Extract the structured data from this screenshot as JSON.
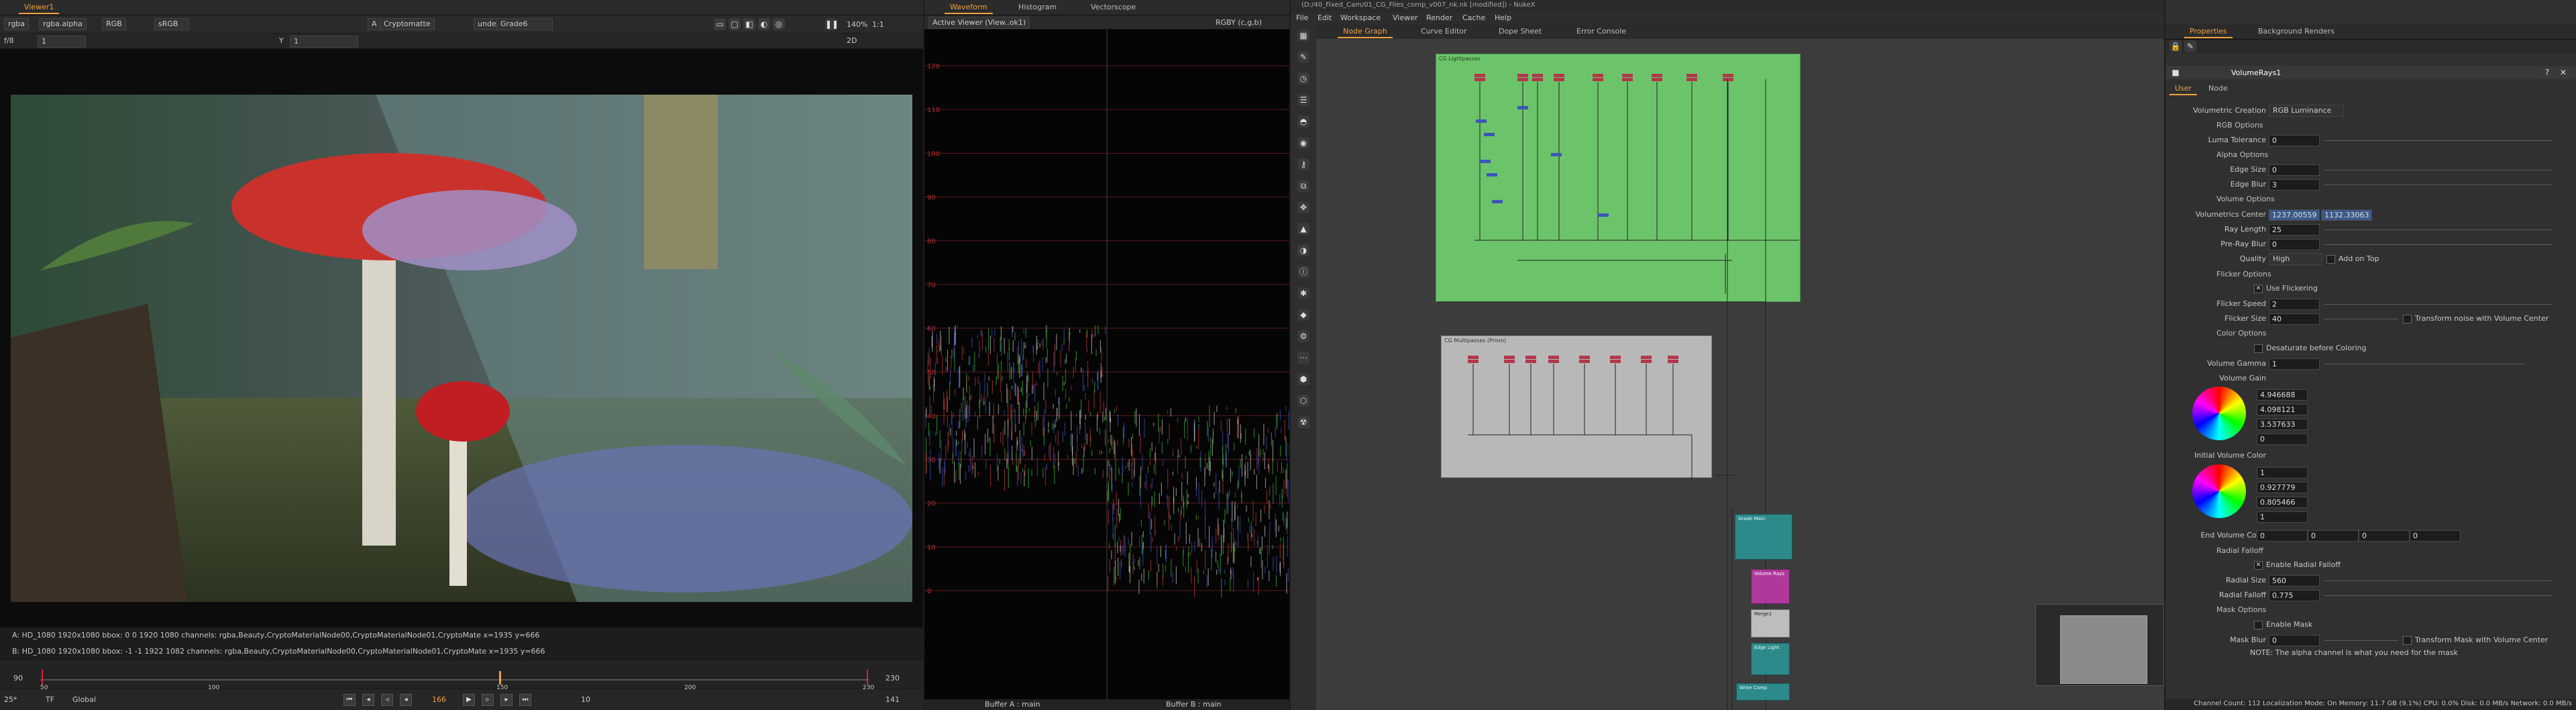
{
  "viewer": {
    "tab": "Viewer1",
    "toolbar": {
      "channels": "rgba",
      "channel_mode": "rgba.alpha",
      "display_mode": "RGB",
      "colorspace": "sRGB",
      "input_a": "A",
      "crypto": "Cryptomatte",
      "compare": "under",
      "input_b": "B",
      "grade": "Grade6",
      "zoom": "140%",
      "proxy": "1:1",
      "ratio_label": "f/8",
      "frame_field": "1",
      "y_label": "Y",
      "y_value": "1",
      "view_mode": "2D"
    },
    "info_a": "A:  HD_1080 1920x1080  bbox: 0 0 1920 1080 channels: rgba,Beauty,CryptoMaterialNode00,CryptoMaterialNode01,CryptoMate  x=1935 y=666",
    "info_b": "B:  HD_1080 1920x1080  bbox: -1 -1 1922 1082 channels: rgba,Beauty,CryptoMaterialNode00,CryptoMaterialNode01,CryptoMate  x=1935 y=666",
    "timeline": {
      "start": "90",
      "end": "230",
      "ticks": [
        "50",
        "100",
        "150",
        "200",
        "230"
      ],
      "fps": "25*",
      "tf": "TF",
      "scope": "Global",
      "current_frame": "166",
      "step": "10",
      "end_frame_field": "141"
    }
  },
  "scopes": {
    "tabs": [
      "Waveform",
      "Histogram",
      "Vectorscope"
    ],
    "active_tab": "Waveform",
    "source": "Active Viewer (View..ok1)",
    "mode": "RGBY (c,g,b)",
    "y_ticks": [
      "120",
      "110",
      "100",
      "90",
      "80",
      "70",
      "60",
      "50",
      "40",
      "30",
      "20",
      "10",
      "0"
    ],
    "buffer_a": "Buffer A : main",
    "buffer_b": "Buffer B : main"
  },
  "nodegraph": {
    "title": "(D:/40_Fixed_Cam/01_CG_Files_comp_v007_nk.nk [modified]) - NukeX",
    "menu": [
      "File",
      "Edit",
      "Workspace",
      "Viewer",
      "Render",
      "Cache",
      "Help"
    ],
    "tabs": [
      "Node Graph",
      "Curve Editor",
      "Dope Sheet",
      "Error Console"
    ],
    "backdrop_green_label": "CG Lightpasses",
    "backdrop_grey_label": "CG Multipasses (Prism)",
    "teal_nodes": [
      "Grade Main",
      "Volume Rays",
      "Merge1",
      "Edge Light",
      "Write Comp"
    ],
    "colors": {
      "backdrop_green": "#6cc46a",
      "backdrop_grey": "#b8b8b8",
      "teal": "#2d8a8a",
      "magenta": "#b0389c",
      "node_red": "#b3374a"
    }
  },
  "properties": {
    "tabs": [
      "Properties",
      "Background Renders"
    ],
    "node_name": "VolumeRays1",
    "sub_tabs": [
      "User",
      "Node"
    ],
    "volumetric_creation_label": "Volumetric Creation",
    "volumetric_creation": "RGB Luminance",
    "rgb_options": "RGB Options",
    "luma_tolerance_label": "Luma Tolerance",
    "luma_tolerance": "0",
    "alpha_options": "Alpha Options",
    "edge_size_label": "Edge Size",
    "edge_size": "0",
    "edge_blur_label": "Edge Blur",
    "edge_blur": "3",
    "volume_options": "Volume Options",
    "volumetrics_center_label": "Volumetrics Center",
    "center_x": "1237.00559",
    "center_y": "1132.33063",
    "ray_length_label": "Ray Length",
    "ray_length": "25",
    "pre_ray_blur_label": "Pre-Ray Blur",
    "pre_ray_blur": "0",
    "quality_label": "Quality",
    "quality": "High",
    "add_on_top": "Add on Top",
    "flicker_options": "Flicker Options",
    "use_flickering": "Use Flickering",
    "flicker_speed_label": "Flicker Speed",
    "flicker_speed": "2",
    "flicker_size_label": "Flicker Size",
    "flicker_size": "40",
    "transform_noise": "Transform noise with Volume Center",
    "color_options": "Color Options",
    "desaturate": "Desaturate before Coloring",
    "volume_gamma_label": "Volume Gamma",
    "volume_gamma": "1",
    "volume_gain_label": "Volume Gain",
    "volume_gain": [
      "4.946688",
      "4.098121",
      "3.537633",
      "0"
    ],
    "initial_volume_color_label": "Initial Volume Color",
    "initial_volume_color": [
      "1",
      "0.927779",
      "0.805466",
      "1"
    ],
    "end_volume_color_label": "End Volume Color",
    "end_volume_color": [
      "0",
      "0",
      "0",
      "0"
    ],
    "radial_falloff": "Radial Falloff",
    "enable_radial": "Enable Radial Falloff",
    "radial_size_label": "Radial Size",
    "radial_size": "560",
    "radial_falloff_label": "Radial Falloff",
    "radial_falloff_value": "0.775",
    "mask_options": "Mask Options",
    "enable_mask": "Enable Mask",
    "mask_blur_label": "Mask Blur",
    "mask_blur": "0",
    "transform_mask": "Transform Mask with Volume Center",
    "note": "NOTE:  The alpha channel is what you need for the mask",
    "status": "Channel Count: 112  Localization Mode: On  Memory: 11.7 GB (9.1%)  CPU: 0.0%  Disk: 0.0 MB/s  Network: 0.0 MB/s"
  }
}
